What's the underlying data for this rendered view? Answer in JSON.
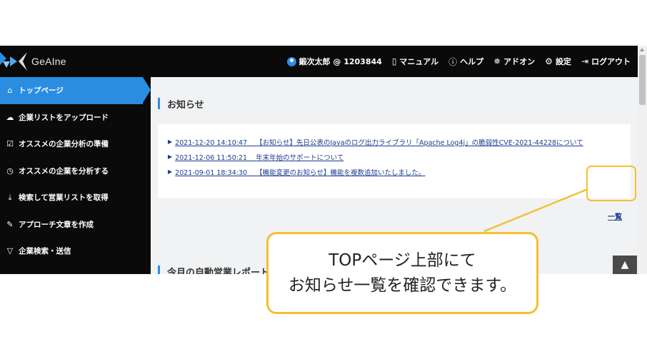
{
  "app": {
    "logo_text": "GeAIne"
  },
  "header": {
    "user": "鍛次太郎 @ 1203844",
    "manual": "マニュアル",
    "help": "ヘルプ",
    "addon": "アドオン",
    "settings": "設定",
    "logout": "ログアウト"
  },
  "sidebar": {
    "items": [
      {
        "label": "トップページ",
        "icon": "home-icon",
        "active": true
      },
      {
        "label": "企業リストをアップロード",
        "icon": "cloud-upload-icon"
      },
      {
        "label": "オススメの企業分析の準備",
        "icon": "checkbox-icon"
      },
      {
        "label": "オススメの企業を分析する",
        "icon": "clock-icon"
      },
      {
        "label": "検索して営業リストを取得",
        "icon": "download-icon"
      },
      {
        "label": "アプローチ文章を作成",
        "icon": "edit-icon"
      },
      {
        "label": "企業検索・送信",
        "icon": "send-icon"
      }
    ]
  },
  "main": {
    "news_title": "お知らせ",
    "news": [
      {
        "datetime": "2021-12-20 14:10:47",
        "text": "【お知らせ】先日公表のJavaのログ出力ライブラリ「Apache Log4j」の脆弱性CVE-2021-44228について"
      },
      {
        "datetime": "2021-12-06 11:50:21",
        "text": "年末年始のサポートについて"
      },
      {
        "datetime": "2021-09-01 18:34:30",
        "text": "【機能変更のお知らせ】機能を複数追加いたしました。"
      }
    ],
    "more_link": "一覧",
    "next_section_title": "今月の自動営業レポート"
  },
  "annotation": {
    "line1": "TOPページ上部にて",
    "line2": "お知らせ一覧を確認できます。",
    "accent_color": "#f2c12e"
  },
  "colors": {
    "header_bg": "#0a0a0a",
    "active_item": "#2a8de0",
    "link": "#1a3d8f"
  }
}
